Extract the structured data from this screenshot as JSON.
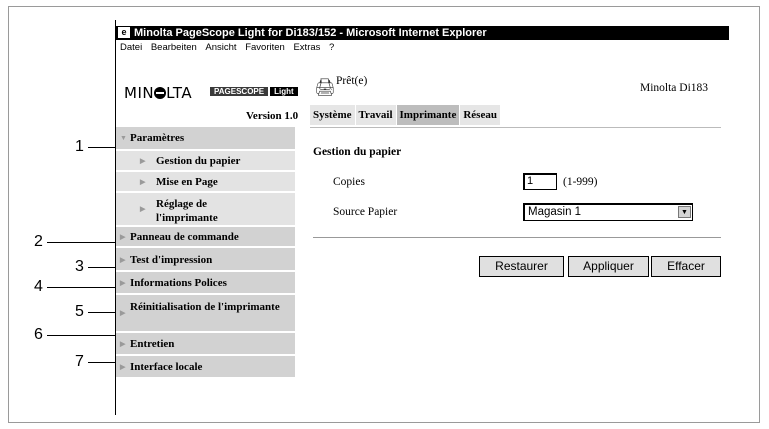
{
  "window": {
    "title": "Minolta PageScope Light for Di183/152 - Microsoft Internet Explorer",
    "menu": [
      "Datei",
      "Bearbeiten",
      "Ansicht",
      "Favoriten",
      "Extras",
      "?"
    ]
  },
  "branding": {
    "logo": "MINOLTA",
    "product_a": "PAGESCOPE",
    "product_b": "Light",
    "version": "Version 1.0"
  },
  "status": {
    "text": "Prêt(e)",
    "model": "Minolta Di183"
  },
  "tabs": [
    "Système",
    "Travail",
    "Imprimante",
    "Réseau"
  ],
  "sidebar": {
    "items": [
      "Paramètres",
      "Gestion du papier",
      "Mise en Page",
      "Réglage de l'imprimante",
      "Panneau de commande",
      "Test d'impression",
      "Informations Polices",
      "Réinitialisation de l'imprimante",
      "Entretien",
      "Interface locale"
    ]
  },
  "form": {
    "section_title": "Gestion du papier",
    "copies_label": "Copies",
    "copies_value": "1",
    "copies_range": "(1-999)",
    "source_label": "Source Papier",
    "source_value": "Magasin 1"
  },
  "buttons": {
    "restore": "Restaurer",
    "apply": "Appliquer",
    "clear": "Effacer"
  },
  "callouts": [
    "1",
    "2",
    "3",
    "4",
    "5",
    "6",
    "7"
  ]
}
